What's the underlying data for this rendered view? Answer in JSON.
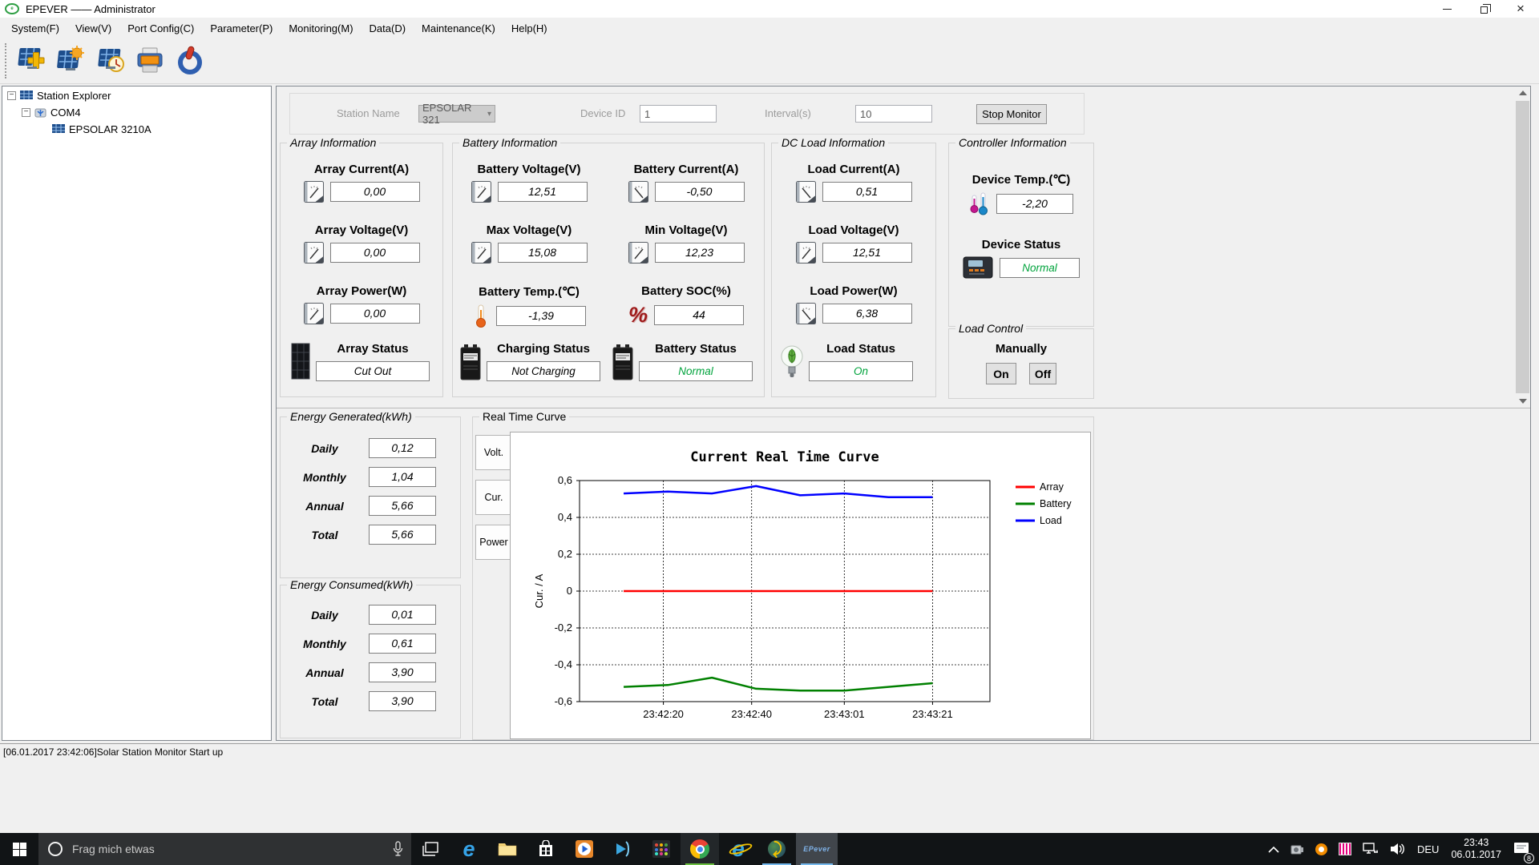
{
  "window": {
    "title": "EPEVER —— Administrator"
  },
  "menu": {
    "items": [
      "System(F)",
      "View(V)",
      "Port Config(C)",
      "Parameter(P)",
      "Monitoring(M)",
      "Data(D)",
      "Maintenance(K)",
      "Help(H)"
    ]
  },
  "toolbar": {
    "icons": [
      "add-station",
      "station-monitor",
      "data-history",
      "print",
      "power"
    ]
  },
  "tree": {
    "items": [
      {
        "label": "Station Explorer"
      },
      {
        "label": "COM4"
      },
      {
        "label": "EPSOLAR 3210A"
      }
    ]
  },
  "monitor_bar": {
    "station_name_label": "Station Name",
    "station_name": "EPSOLAR 321",
    "device_id_label": "Device ID",
    "device_id": "1",
    "interval_label": "Interval(s)",
    "interval": "10",
    "stop_button": "Stop Monitor"
  },
  "array_info": {
    "title": "Array Information",
    "fields": [
      {
        "label": "Array Current(A)",
        "value": "0,00"
      },
      {
        "label": "Array Voltage(V)",
        "value": "0,00"
      },
      {
        "label": "Array Power(W)",
        "value": "0,00"
      }
    ],
    "status": {
      "label": "Array Status",
      "value": "Cut Out",
      "color": "#000000"
    }
  },
  "battery_info": {
    "title": "Battery Information",
    "fields": [
      {
        "label": "Battery Voltage(V)",
        "value": "12,51"
      },
      {
        "label": "Battery Current(A)",
        "value": "-0,50"
      },
      {
        "label": "Max Voltage(V)",
        "value": "15,08"
      },
      {
        "label": "Min Voltage(V)",
        "value": "12,23"
      },
      {
        "label": "Battery Temp.(℃)",
        "value": "-1,39"
      },
      {
        "label": "Battery SOC(%)",
        "value": "44"
      }
    ],
    "charging_status": {
      "label": "Charging Status",
      "value": "Not Charging",
      "color": "#000000"
    },
    "battery_status": {
      "label": "Battery Status",
      "value": "Normal",
      "color": "#00a33c"
    }
  },
  "dc_load_info": {
    "title": "DC Load Information",
    "fields": [
      {
        "label": "Load Current(A)",
        "value": "0,51"
      },
      {
        "label": "Load Voltage(V)",
        "value": "12,51"
      },
      {
        "label": "Load Power(W)",
        "value": "6,38"
      }
    ],
    "status": {
      "label": "Load Status",
      "value": "On",
      "color": "#00a33c"
    }
  },
  "controller_info": {
    "title": "Controller Information",
    "temp_label": "Device Temp.(℃)",
    "temp_value": "-2,20",
    "status_label": "Device Status",
    "status_value": "Normal",
    "status_color": "#00a33c"
  },
  "load_control": {
    "title": "Load Control",
    "manually_label": "Manually",
    "on_button": "On",
    "off_button": "Off"
  },
  "energy_generated": {
    "title": "Energy Generated(kWh)",
    "rows": [
      {
        "label": "Daily",
        "value": "0,12"
      },
      {
        "label": "Monthly",
        "value": "1,04"
      },
      {
        "label": "Annual",
        "value": "5,66"
      },
      {
        "label": "Total",
        "value": "5,66"
      }
    ]
  },
  "energy_consumed": {
    "title": "Energy Consumed(kWh)",
    "rows": [
      {
        "label": "Daily",
        "value": "0,01"
      },
      {
        "label": "Monthly",
        "value": "0,61"
      },
      {
        "label": "Annual",
        "value": "3,90"
      },
      {
        "label": "Total",
        "value": "3,90"
      }
    ]
  },
  "curve": {
    "title": "Real Time Curve",
    "tabs": [
      "Volt.",
      "Cur.",
      "Power"
    ],
    "active_tab": "Cur."
  },
  "chart_data": {
    "type": "line",
    "title": "Current Real Time Curve",
    "ylabel": "Cur. / A",
    "ylim": [
      -0.6,
      0.6
    ],
    "yticks": [
      {
        "v": 0.6,
        "label": "0,6"
      },
      {
        "v": 0.4,
        "label": "0,4"
      },
      {
        "v": 0.2,
        "label": "0,2"
      },
      {
        "v": 0,
        "label": "0"
      },
      {
        "v": -0.2,
        "label": "-0,2"
      },
      {
        "v": -0.4,
        "label": "-0,4"
      },
      {
        "v": -0.6,
        "label": "-0,6"
      }
    ],
    "xlim": [
      1,
      94
    ],
    "xticks": [
      {
        "v": 20,
        "label": "23:42:20"
      },
      {
        "v": 40,
        "label": "23:42:40"
      },
      {
        "v": 61,
        "label": "23:43:01"
      },
      {
        "v": 81,
        "label": "23:43:21"
      }
    ],
    "x": [
      11,
      21,
      31,
      41,
      51,
      61,
      71,
      81
    ],
    "series": [
      {
        "name": "Array",
        "color": "#ff0000",
        "values": [
          0,
          0,
          0,
          0,
          0,
          0,
          0,
          0
        ]
      },
      {
        "name": "Battery",
        "color": "#008000",
        "values": [
          -0.52,
          -0.51,
          -0.47,
          -0.53,
          -0.54,
          -0.54,
          -0.52,
          -0.5
        ]
      },
      {
        "name": "Load",
        "color": "#0000ff",
        "values": [
          0.53,
          0.54,
          0.53,
          0.57,
          0.52,
          0.53,
          0.51,
          0.51
        ]
      }
    ],
    "grid": true,
    "legend_position": "right"
  },
  "log": {
    "text": "[06.01.2017 23:42:06]Solar Station Monitor Start up"
  },
  "taskbar": {
    "search_placeholder": "Frag mich etwas",
    "tray": {
      "language": "DEU",
      "time": "23:43",
      "date": "06.01.2017",
      "notification_count": "8"
    }
  }
}
